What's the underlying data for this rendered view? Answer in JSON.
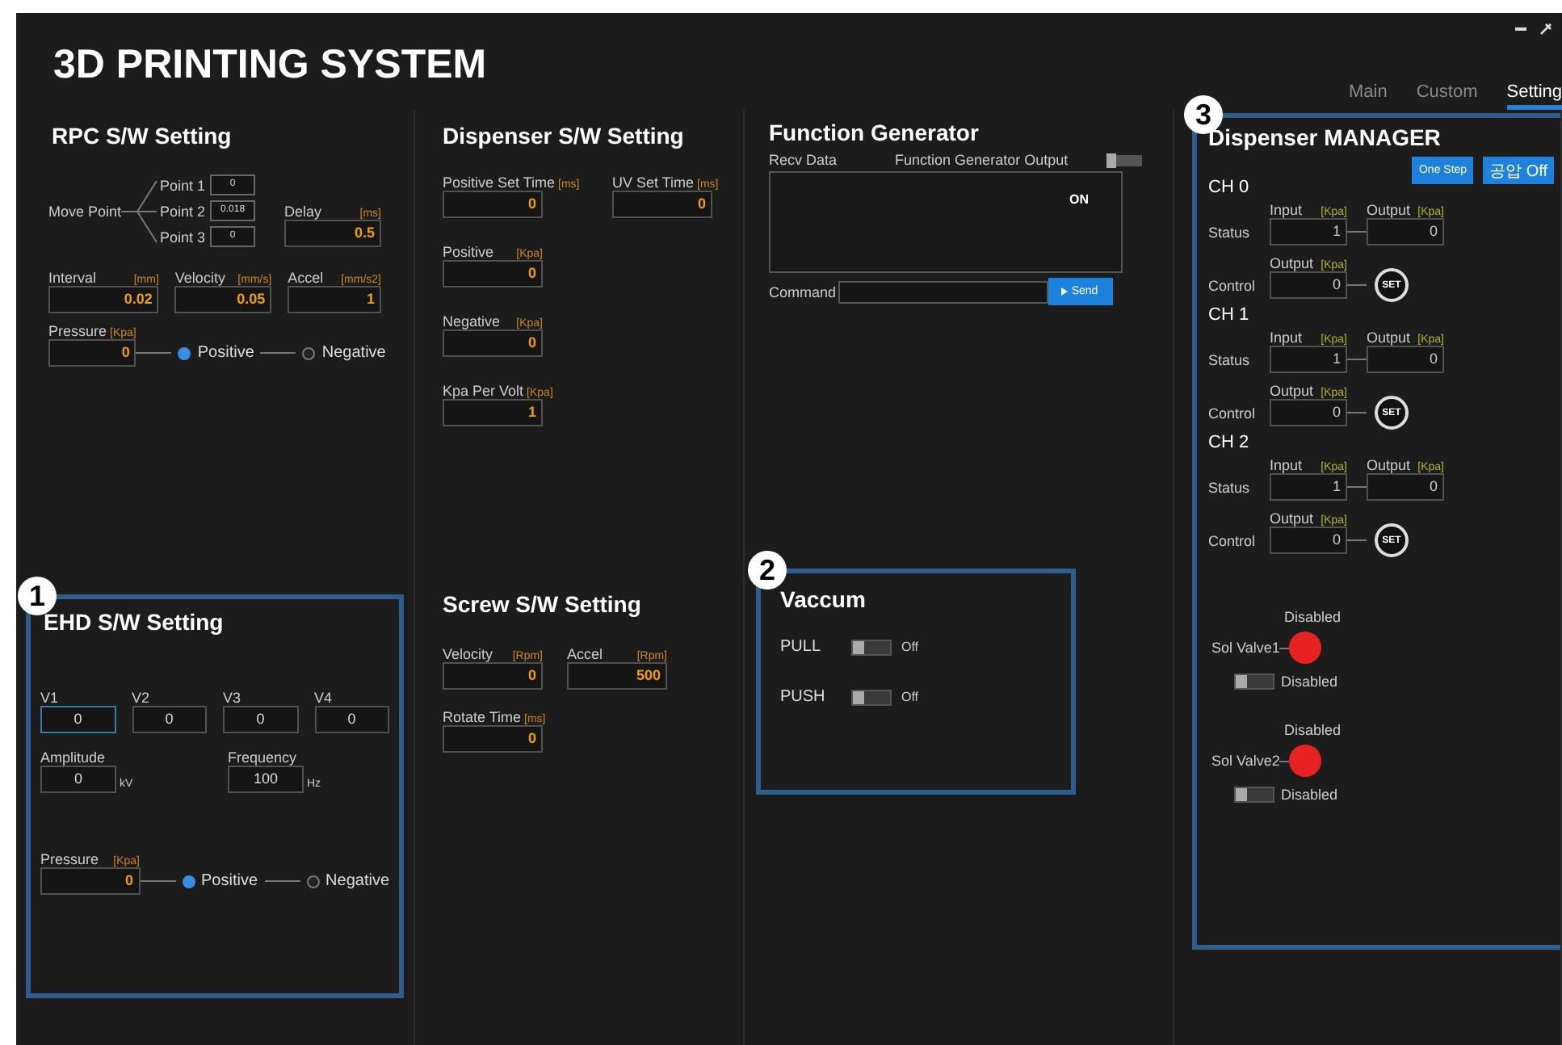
{
  "header": {
    "title": "3D PRINTING SYSTEM",
    "tabs": [
      {
        "label": "Main",
        "selected": false
      },
      {
        "label": "Custom",
        "selected": false
      },
      {
        "label": "Setting",
        "selected": true
      }
    ]
  },
  "rpc": {
    "title": "RPC S/W Setting",
    "move_point": {
      "label": "Move Point",
      "points": [
        {
          "label": "Point 1",
          "value": "0"
        },
        {
          "label": "Point 2",
          "value": "0.018"
        },
        {
          "label": "Point 3",
          "value": "0"
        }
      ]
    },
    "delay": {
      "label": "Delay",
      "unit": "[ms]",
      "value": "0.5"
    },
    "fields": [
      {
        "label": "Interval",
        "unit": "[mm]",
        "value": "0.02"
      },
      {
        "label": "Velocity",
        "unit": "[mm/s]",
        "value": "0.05"
      },
      {
        "label": "Accel",
        "unit": "[mm/s2]",
        "value": "1"
      }
    ],
    "pressure": {
      "label": "Pressure",
      "unit": "[Kpa]",
      "value": "0",
      "options": [
        {
          "label": "Positive",
          "selected": true
        },
        {
          "label": "Negative",
          "selected": false
        }
      ]
    }
  },
  "ehd": {
    "callout": "1",
    "title": "EHD S/W Setting",
    "voltages": [
      {
        "label": "V1",
        "value": "0",
        "focused": true
      },
      {
        "label": "V2",
        "value": "0",
        "focused": false
      },
      {
        "label": "V3",
        "value": "0",
        "focused": false
      },
      {
        "label": "V4",
        "value": "0",
        "focused": false
      }
    ],
    "amplitude": {
      "label": "Amplitude",
      "value": "0",
      "unit": "kV"
    },
    "frequency": {
      "label": "Frequency",
      "value": "100",
      "unit": "Hz"
    },
    "pressure": {
      "label": "Pressure",
      "unit": "[Kpa]",
      "value": "0",
      "options": [
        {
          "label": "Positive",
          "selected": true
        },
        {
          "label": "Negative",
          "selected": false
        }
      ]
    }
  },
  "dispenser": {
    "title": "Dispenser S/W Setting",
    "fields": [
      {
        "label": "Positive Set Time",
        "unit": "[ms]",
        "value": "0"
      },
      {
        "label": "UV Set Time",
        "unit": "[ms]",
        "value": "0"
      },
      {
        "label": "Positive",
        "unit": "[Kpa]",
        "value": "0"
      },
      {
        "label": "Negative",
        "unit": "[Kpa]",
        "value": "0"
      },
      {
        "label": "Kpa Per Volt",
        "unit": "[Kpa]",
        "value": "1"
      }
    ]
  },
  "screw": {
    "title": "Screw S/W Setting",
    "fields": [
      {
        "label": "Velocity",
        "unit": "[Rpm]",
        "value": "0"
      },
      {
        "label": "Accel",
        "unit": "[Rpm]",
        "value": "500"
      },
      {
        "label": "Rotate Time",
        "unit": "[ms]",
        "value": "0"
      }
    ]
  },
  "function_generator": {
    "title": "Function Generator",
    "recv_label": "Recv Data",
    "output_label": "Function Generator Output",
    "output_on": false,
    "recv_text": "ON",
    "command_label": "Command",
    "send_button": "Send"
  },
  "vaccum": {
    "callout": "2",
    "title": "Vaccum",
    "rows": [
      {
        "label": "PULL",
        "on": false,
        "state": "Off"
      },
      {
        "label": "PUSH",
        "on": false,
        "state": "Off"
      }
    ]
  },
  "manager": {
    "callout": "3",
    "title": "Dispenser MANAGER",
    "buttons": [
      "One Step",
      "공압 Off"
    ],
    "channels": [
      {
        "name": "CH 0",
        "status_label": "Status",
        "input": {
          "label": "Input",
          "unit": "[Kpa]",
          "value": "1"
        },
        "output": {
          "label": "Output",
          "unit": "[Kpa]",
          "value": "0"
        },
        "control_label": "Control",
        "control": {
          "label": "Output",
          "unit": "[Kpa]",
          "value": "0"
        },
        "set_button": "SET"
      },
      {
        "name": "CH 1",
        "status_label": "Status",
        "input": {
          "label": "Input",
          "unit": "[Kpa]",
          "value": "1"
        },
        "output": {
          "label": "Output",
          "unit": "[Kpa]",
          "value": "0"
        },
        "control_label": "Control",
        "control": {
          "label": "Output",
          "unit": "[Kpa]",
          "value": "0"
        },
        "set_button": "SET"
      },
      {
        "name": "CH 2",
        "status_label": "Status",
        "input": {
          "label": "Input",
          "unit": "[Kpa]",
          "value": "1"
        },
        "output": {
          "label": "Output",
          "unit": "[Kpa]",
          "value": "0"
        },
        "control_label": "Control",
        "control": {
          "label": "Output",
          "unit": "[Kpa]",
          "value": "0"
        },
        "set_button": "SET"
      }
    ],
    "valves": [
      {
        "status": "Disabled",
        "label": "Sol Valve1",
        "color": "#e82222",
        "on": false,
        "switch_label": "Disabled"
      },
      {
        "status": "Disabled",
        "label": "Sol Valve2",
        "color": "#e82222",
        "on": false,
        "switch_label": "Disabled"
      }
    ]
  }
}
